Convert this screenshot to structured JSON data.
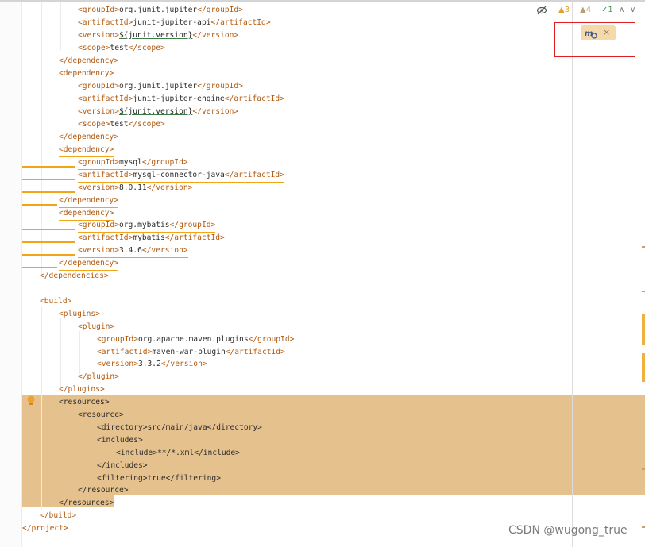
{
  "inspections": {
    "warnings_label": "3",
    "weak_warnings_label": "4",
    "typos_label": "1",
    "nav_up": "∧",
    "nav_down": "∨"
  },
  "maven_popup": {
    "icon": "maven-reload-icon",
    "close_label": "×"
  },
  "watermark": "CSDN @wugong_true",
  "colors": {
    "tag": "#b35a0f",
    "text": "#2d2d2d",
    "highlight": "#e5c18d",
    "warning_underline": "#f2a518",
    "red_box": "#e02020"
  },
  "code": {
    "l01": {
      "a": "<groupId>",
      "b": "org.junit.jupiter",
      "c": "</groupId>"
    },
    "l02": {
      "a": "<artifactId>",
      "b": "junit-jupiter-api",
      "c": "</artifactId>"
    },
    "l03": {
      "a": "<version>",
      "b": "${junit.version}",
      "c": "</version>"
    },
    "l04": {
      "a": "<scope>",
      "b": "test",
      "c": "</scope>"
    },
    "l05": {
      "a": "</dependency>"
    },
    "l06": {
      "a": "<dependency>"
    },
    "l07": {
      "a": "<groupId>",
      "b": "org.junit.jupiter",
      "c": "</groupId>"
    },
    "l08": {
      "a": "<artifactId>",
      "b": "junit-jupiter-engine",
      "c": "</artifactId>"
    },
    "l09": {
      "a": "<version>",
      "b": "${junit.version}",
      "c": "</version>"
    },
    "l10": {
      "a": "<scope>",
      "b": "test",
      "c": "</scope>"
    },
    "l11": {
      "a": "</dependency>"
    },
    "l12": {
      "a": "<dependency>"
    },
    "l13": {
      "a": "<groupId>",
      "b": "mysql",
      "c": "</groupId>"
    },
    "l14": {
      "a": "<artifactId>",
      "b": "mysql-connector-java",
      "c": "</artifactId>"
    },
    "l15": {
      "a": "<version>",
      "b": "8.0.11",
      "c": "</version>"
    },
    "l16": {
      "a": "</dependency>"
    },
    "l17": {
      "a": "<dependency>"
    },
    "l18": {
      "a": "<groupId>",
      "b": "org.mybatis",
      "c": "</groupId>"
    },
    "l19": {
      "a": "<artifactId>",
      "b": "mybatis",
      "c": "</artifactId>"
    },
    "l20": {
      "a": "<version>",
      "b": "3.4.6",
      "c": "</version>"
    },
    "l21": {
      "a": "</dependency>"
    },
    "l22": {
      "a": "</dependencies>"
    },
    "l24": {
      "a": "<build>"
    },
    "l25": {
      "a": "<plugins>"
    },
    "l26": {
      "a": "<plugin>"
    },
    "l27": {
      "a": "<groupId>",
      "b": "org.apache.maven.plugins",
      "c": "</groupId>"
    },
    "l28": {
      "a": "<artifactId>",
      "b": "maven-war-plugin",
      "c": "</artifactId>"
    },
    "l29": {
      "a": "<version>",
      "b": "3.3.2",
      "c": "</version>"
    },
    "l30": {
      "a": "</plugin>"
    },
    "l31": {
      "a": "</plugins>"
    },
    "l32": {
      "a": "<resources>"
    },
    "l33": {
      "a": "<resource>"
    },
    "l34": {
      "a": "<directory>",
      "b": "src/main/java",
      "c": "</directory>"
    },
    "l35": {
      "a": "<includes>"
    },
    "l36": {
      "a": "<include>",
      "b": "**/*.xml",
      "c": "</include>"
    },
    "l37": {
      "a": "</includes>"
    },
    "l38": {
      "a": "<filtering>",
      "b": "true",
      "c": "</filtering>"
    },
    "l39": {
      "a": "</resource>"
    },
    "l40": {
      "a": "</resources>"
    },
    "l41": {
      "a": "</build>"
    },
    "l42": {
      "a": "</project>"
    }
  }
}
